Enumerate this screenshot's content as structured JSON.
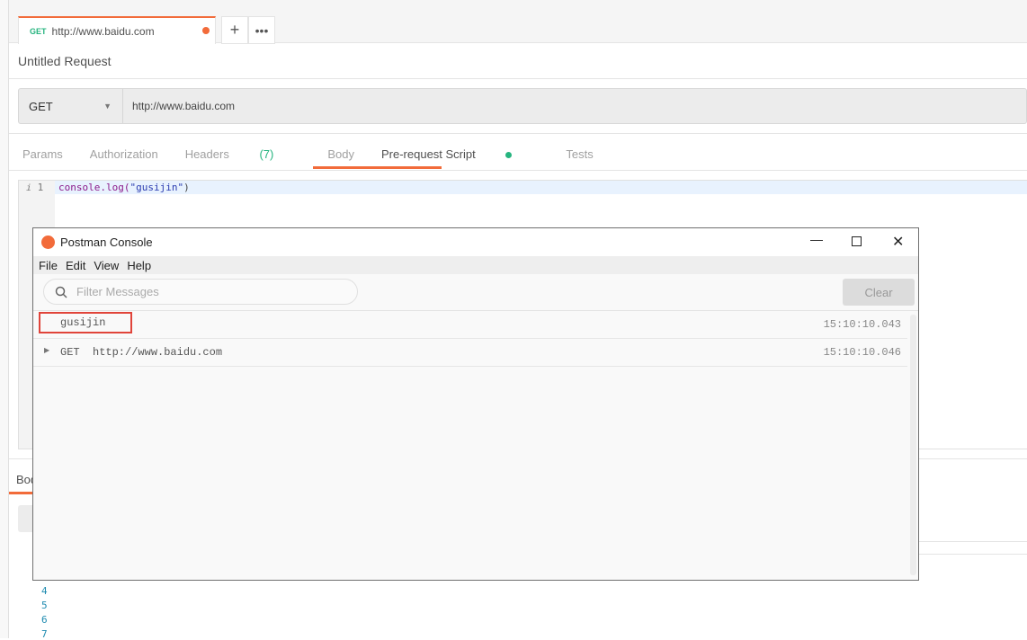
{
  "tab": {
    "method": "GET",
    "url": "http://www.baidu.com"
  },
  "request": {
    "title": "Untitled Request",
    "method": "GET",
    "url": "http://www.baidu.com"
  },
  "tabs": [
    {
      "label": "Params"
    },
    {
      "label": "Authorization"
    },
    {
      "label": "Headers",
      "count": "(7)"
    },
    {
      "label": "Body"
    },
    {
      "label": "Pre-request Script"
    },
    {
      "label": "Tests"
    }
  ],
  "editor": {
    "line": "1",
    "code_fn": "console.log(",
    "code_str": "\"gusijin\"",
    "code_end": ")"
  },
  "response": {
    "tab": "Body",
    "line_numbers": [
      "4",
      "5",
      "6",
      "7"
    ]
  },
  "console": {
    "title": "Postman Console",
    "menu": [
      "File",
      "Edit",
      "View",
      "Help"
    ],
    "filter_placeholder": "Filter Messages",
    "clear": "Clear",
    "logs": [
      {
        "text": "gusijin",
        "time": "15:10:10.043"
      },
      {
        "text": "GET  http://www.baidu.com",
        "time": "15:10:10.046"
      }
    ]
  },
  "colors": {
    "accent": "#f26b3a",
    "success": "#26b47f"
  }
}
